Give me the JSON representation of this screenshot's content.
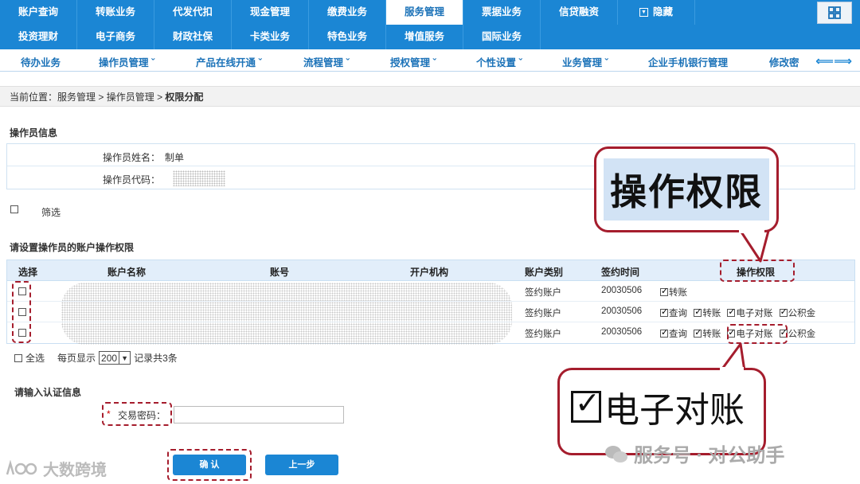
{
  "nav": {
    "row1": [
      "账户查询",
      "转账业务",
      "代发代扣",
      "现金管理",
      "缴费业务",
      "服务管理",
      "票据业务",
      "信贷融资"
    ],
    "hide_label": "隐藏",
    "row2": [
      "投资理财",
      "电子商务",
      "财政社保",
      "卡类业务",
      "特色业务",
      "增值服务",
      "国际业务"
    ],
    "active": "服务管理"
  },
  "subnav": {
    "items": [
      "待办业务",
      "操作员管理 ˇ",
      "产品在线开通 ˇ",
      "流程管理 ˇ",
      "授权管理 ˇ",
      "个性设置 ˇ",
      "业务管理 ˇ",
      "企业手机银行管理",
      "修改密"
    ]
  },
  "breadcrumb": {
    "prefix": "当前位置：",
    "path1": "服务管理",
    "path2": "操作员管理",
    "current": "权限分配"
  },
  "operator_info": {
    "title": "操作员信息",
    "name_label": "操作员姓名：",
    "name_value": "制单",
    "code_label": "操作员代码："
  },
  "filter": {
    "label": "筛选"
  },
  "permissions": {
    "title": "请设置操作员的账户操作权限",
    "headers": [
      "选择",
      "账户名称",
      "账号",
      "开户机构",
      "账户类别",
      "签约时间",
      "操作权限"
    ],
    "rows": [
      {
        "type": "签约账户",
        "date": "20030506",
        "perms": [
          "转账"
        ]
      },
      {
        "type": "签约账户",
        "date": "20030506",
        "perms": [
          "查询",
          "转账",
          "电子对账",
          "公积金"
        ]
      },
      {
        "type": "签约账户",
        "date": "20030506",
        "perms": [
          "查询",
          "转账",
          "电子对账",
          "公积金"
        ]
      }
    ],
    "select_all": "全选",
    "per_page_label": "每页显示",
    "per_page_value": "200",
    "records_label": "记录共3条"
  },
  "auth": {
    "title": "请输入认证信息",
    "required_mark": "*",
    "password_label": "交易密码："
  },
  "buttons": {
    "confirm": "确 认",
    "back": "上一步"
  },
  "callouts": {
    "top": "操作权限",
    "bottom": "电子对账"
  },
  "watermarks": {
    "left": "大数跨境",
    "right": "服务号 · 对公助手"
  },
  "colors": {
    "nav_blue": "#1b86d4",
    "highlight_red": "#a51d2d",
    "callout_bg": "#d2e3f5"
  }
}
